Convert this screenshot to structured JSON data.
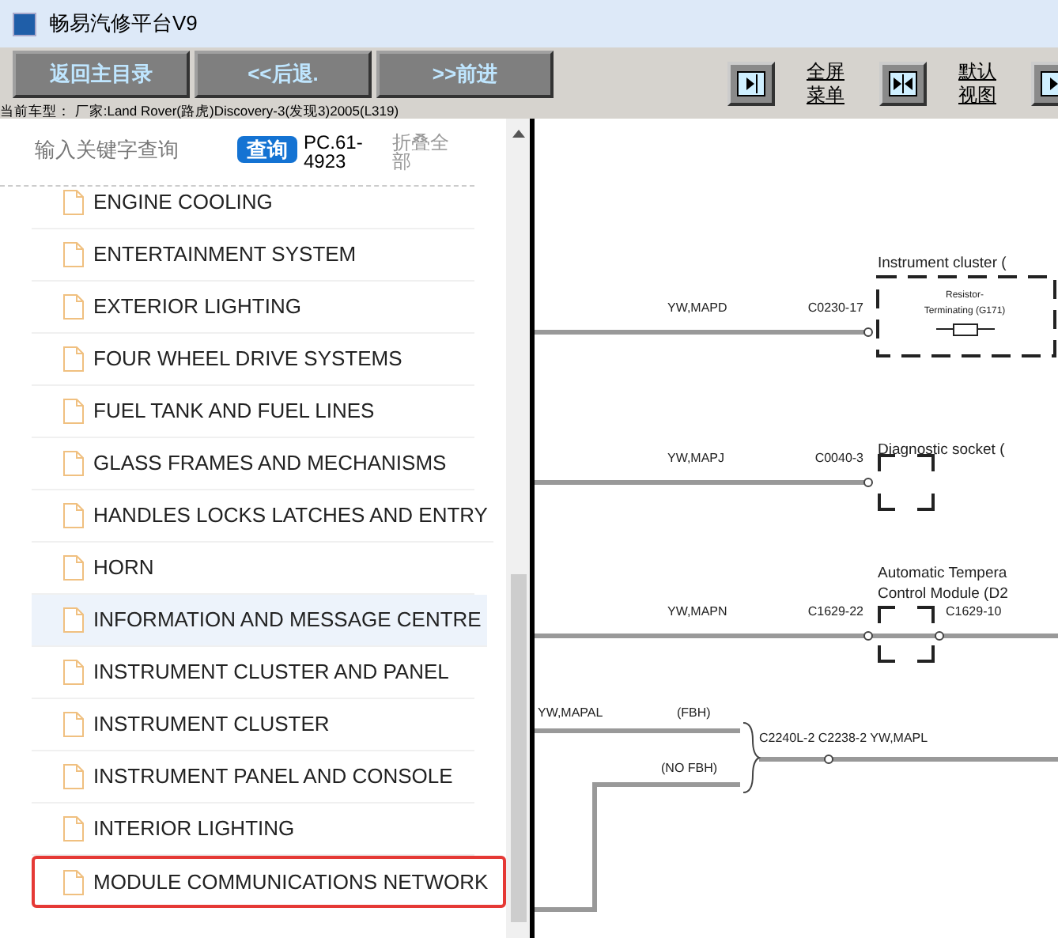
{
  "window": {
    "title": "畅易汽修平台V9"
  },
  "toolbar": {
    "buttons": [
      "返回主目录",
      "<<后退.",
      ">>前进"
    ],
    "view_buttons": [
      {
        "label": "全屏菜单"
      },
      {
        "label": "默认视图"
      }
    ]
  },
  "vehicle": "当前车型： 厂家:Land Rover(路虎)Discovery-3(发现3)2005(L319)",
  "search": {
    "placeholder": "输入关键字查询",
    "button": "查询",
    "code": "PC.61-4923",
    "collapse": "折叠全部"
  },
  "tree": [
    {
      "label": "ENGINE COOLING",
      "selected": false,
      "outlined": false
    },
    {
      "label": "ENTERTAINMENT SYSTEM",
      "selected": false,
      "outlined": false
    },
    {
      "label": "EXTERIOR LIGHTING",
      "selected": false,
      "outlined": false
    },
    {
      "label": "FOUR WHEEL DRIVE SYSTEMS",
      "selected": false,
      "outlined": false
    },
    {
      "label": "FUEL TANK AND FUEL LINES",
      "selected": false,
      "outlined": false
    },
    {
      "label": "GLASS FRAMES AND MECHANISMS",
      "selected": false,
      "outlined": false
    },
    {
      "label": "HANDLES LOCKS LATCHES AND ENTRY",
      "selected": false,
      "outlined": false
    },
    {
      "label": "HORN",
      "selected": false,
      "outlined": false
    },
    {
      "label": "INFORMATION AND MESSAGE CENTRE",
      "selected": true,
      "outlined": false
    },
    {
      "label": "INSTRUMENT CLUSTER AND PANEL",
      "selected": false,
      "outlined": false
    },
    {
      "label": "INSTRUMENT CLUSTER",
      "selected": false,
      "outlined": false
    },
    {
      "label": "INSTRUMENT PANEL AND CONSOLE",
      "selected": false,
      "outlined": false
    },
    {
      "label": "INTERIOR LIGHTING",
      "selected": false,
      "outlined": false
    },
    {
      "label": "MODULE COMMUNICATIONS NETWORK",
      "selected": false,
      "outlined": true
    }
  ],
  "diagram": {
    "components": [
      {
        "kind": "cluster",
        "title": "Instrument cluster (",
        "inner": [
          "Resistor-",
          "Terminating (G171)"
        ],
        "wire": "YW,MAPD",
        "pin": "C0230-17"
      },
      {
        "kind": "socket",
        "title": "Diagnostic socket (",
        "wire": "YW,MAPJ",
        "pin": "C0040-3"
      },
      {
        "kind": "module",
        "title": [
          "Automatic Tempera",
          "Control Module (D2"
        ],
        "wire": "YW,MAPN",
        "pin": "C1629-22",
        "pin_out": "C1629-10"
      }
    ],
    "splice": {
      "wire_in": "YW,MAPAL",
      "branch_a": "(FBH)",
      "branch_b": "(NO FBH)",
      "label": "C2240L-2 C2238-2  YW,MAPL"
    }
  }
}
